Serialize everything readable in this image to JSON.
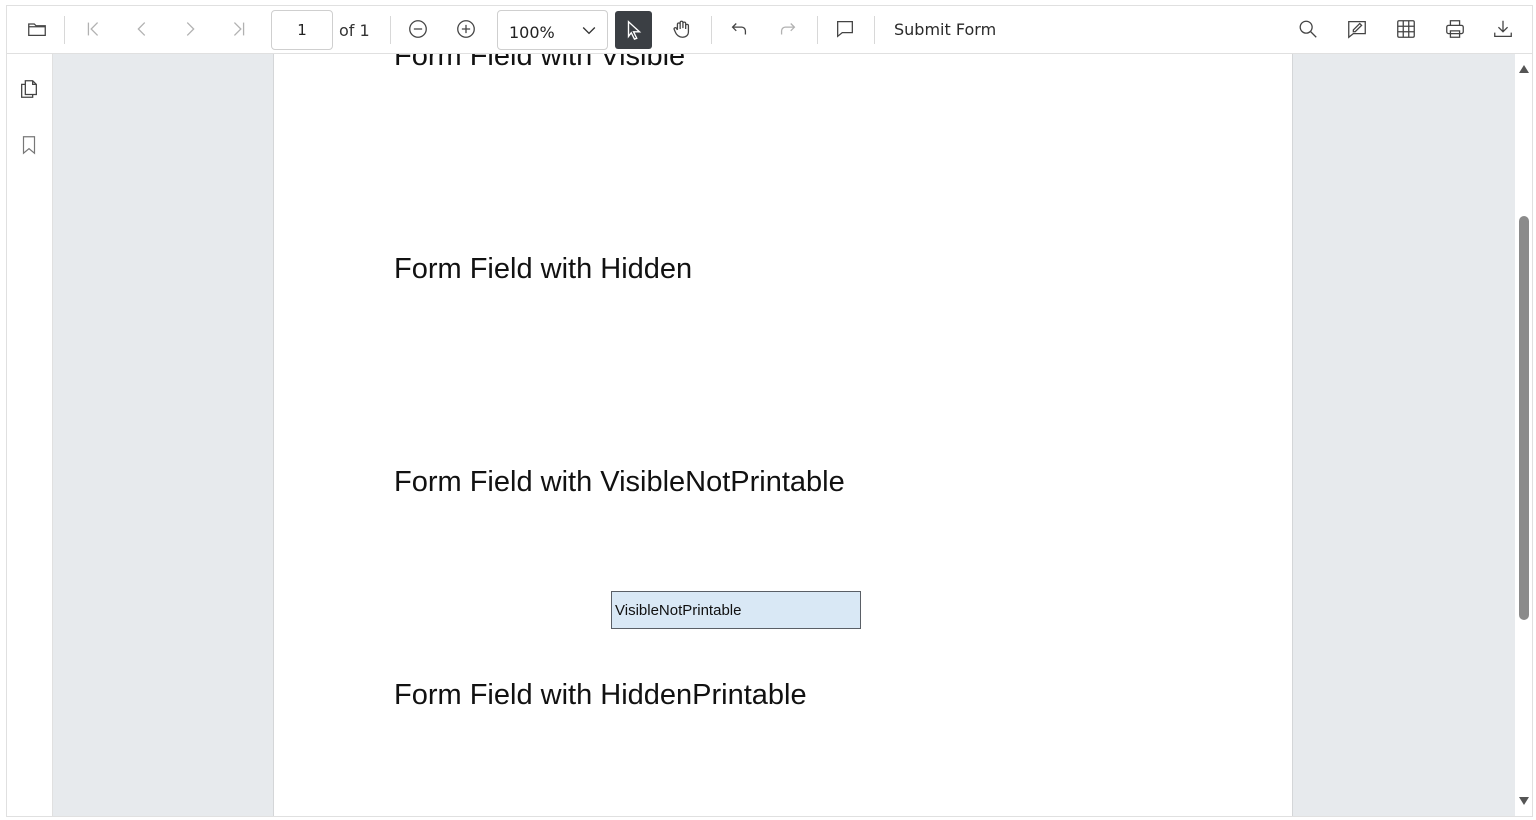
{
  "toolbar": {
    "current_page": "1",
    "page_count_label": "of 1",
    "zoom_value": "100%",
    "submit_form_label": "Submit Form"
  },
  "document": {
    "headings": [
      "Form Field with Visible",
      "Form Field with Hidden",
      "Form Field with VisibleNotPrintable",
      "Form Field with HiddenPrintable"
    ],
    "form_field_value": "VisibleNotPrintable"
  },
  "colors": {
    "active_tool_bg": "#3b3f44",
    "form_field_fill": "#d9e8f5",
    "canvas_bg": "#e7eaed"
  }
}
